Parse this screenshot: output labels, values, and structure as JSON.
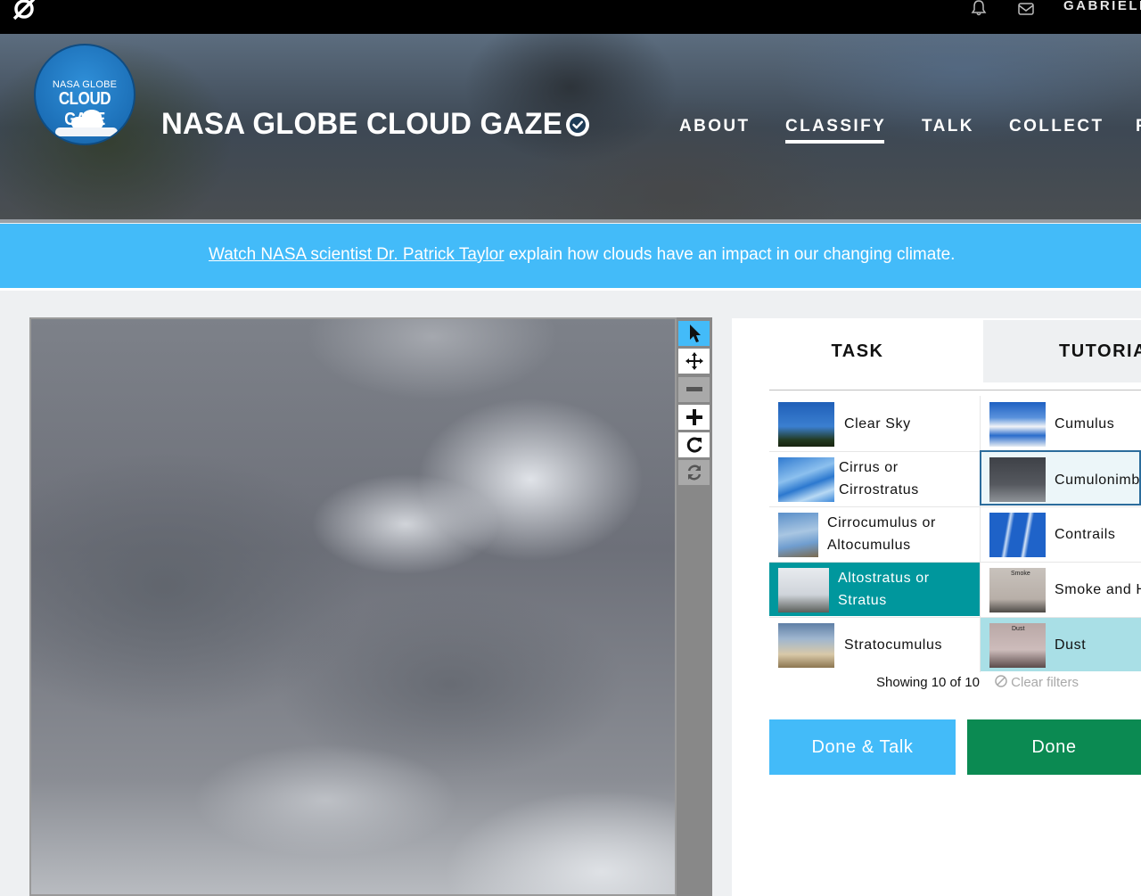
{
  "topbar": {
    "logo_icon": "zooniverse-logo-icon",
    "notifications_icon": "bell-icon",
    "messages_icon": "mail-icon",
    "user": "GABRIELL"
  },
  "header": {
    "badge_line1": "NASA GLOBE",
    "badge_line2": "CLOUD GAZE",
    "title": "NASA GLOBE CLOUD GAZE",
    "verified_icon": "check-badge-icon",
    "nav": [
      "ABOUT",
      "CLASSIFY",
      "TALK",
      "COLLECT",
      "R"
    ],
    "active_nav": "CLASSIFY"
  },
  "banner": {
    "link_text": "Watch NASA scientist Dr. Patrick Taylor",
    "text": " explain how clouds have an impact in our changing climate.",
    "color": "#43bbf9"
  },
  "toolbar": {
    "tools": [
      "pointer-icon",
      "move-icon",
      "zoom-out-icon",
      "zoom-in-icon",
      "rotate-icon",
      "reset-icon"
    ],
    "active": "pointer-icon",
    "disabled": [
      "zoom-out-icon",
      "reset-icon"
    ]
  },
  "panel": {
    "tabs": [
      "TASK",
      "TUTORIAL"
    ],
    "choices": [
      {
        "label": "Clear Sky",
        "state": "none"
      },
      {
        "label": "Cumulus",
        "state": "none"
      },
      {
        "label_lines": [
          "Cirrus or",
          "Cirrostratus"
        ],
        "state": "none"
      },
      {
        "label": "Cumulonimbus",
        "state": "focused"
      },
      {
        "label_lines": [
          "Cirrocumulus or",
          "Altocumulus"
        ],
        "state": "none"
      },
      {
        "label": "Contrails",
        "state": "none"
      },
      {
        "label_lines": [
          "Altostratus or",
          "Stratus"
        ],
        "state": "selected"
      },
      {
        "label": "Smoke and Haze",
        "state": "none"
      },
      {
        "label": "Stratocumulus",
        "state": "none"
      },
      {
        "label": "Dust",
        "state": "hover"
      }
    ],
    "thumb_labels": {
      "smoke": "Smoke",
      "dust": "Dust"
    },
    "showing": "Showing 10 of 10",
    "clear_filters": "Clear filters",
    "clear_icon": "cancel-circle-icon",
    "buttons": {
      "done_talk": "Done & Talk",
      "done": "Done"
    },
    "colors": {
      "selected": "#00979d",
      "done": "#0b8a52",
      "done_talk": "#43bbf9"
    }
  }
}
